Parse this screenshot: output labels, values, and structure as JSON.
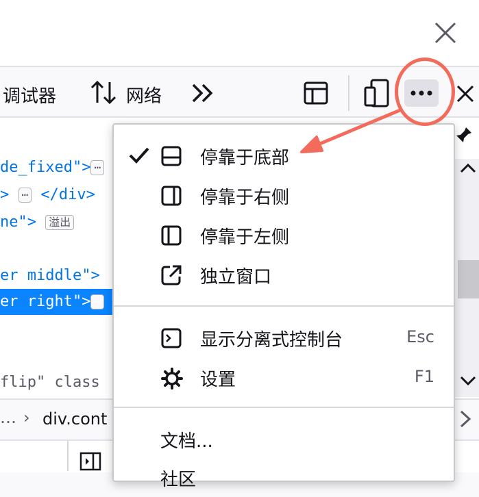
{
  "toolbar": {
    "debugger_label": "调试器",
    "network_label": "网络"
  },
  "code": {
    "line1": "de_fixed\">",
    "line2_close": "</div>",
    "line3": "ne\">",
    "line3_badge": "溢出",
    "line4": "er middle\">",
    "line5": "er right\">",
    "line6": "flip\" class"
  },
  "breadcrumb": {
    "item": "div.cont"
  },
  "menu": {
    "items": [
      {
        "label": "停靠于底部",
        "checked": true
      },
      {
        "label": "停靠于右侧"
      },
      {
        "label": "停靠于左侧"
      },
      {
        "label": "独立窗口"
      },
      {
        "label": "显示分离式控制台",
        "shortcut": "Esc"
      },
      {
        "label": "设置",
        "shortcut": "F1"
      },
      {
        "label": "文档..."
      },
      {
        "label": "社区"
      }
    ]
  },
  "colors": {
    "accent": "#0a84ff",
    "annotation": "#f26b5b"
  }
}
